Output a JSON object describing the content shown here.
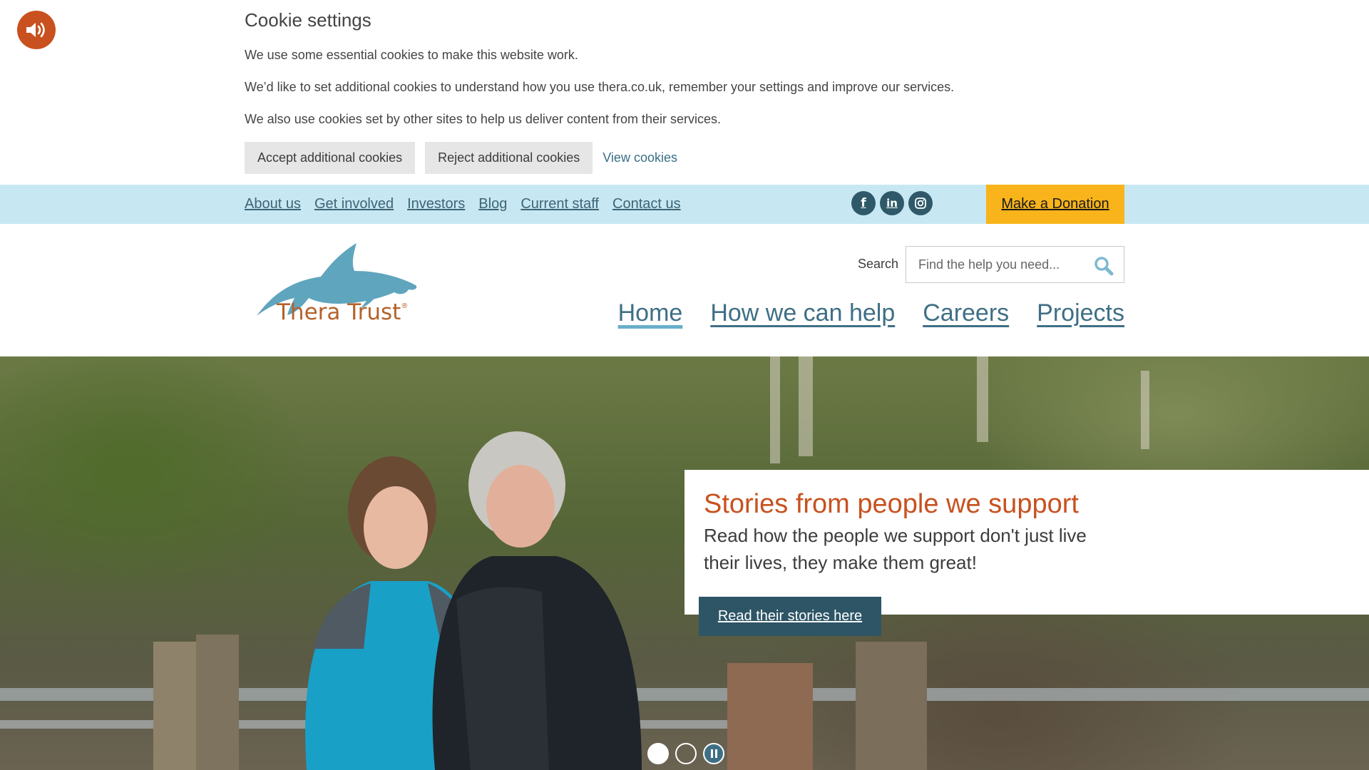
{
  "accessibility": {
    "speaker_icon": "speaker-volume-icon"
  },
  "cookie": {
    "title": "Cookie settings",
    "p1": "We use some essential cookies to make this website work.",
    "p2": "We’d like to set additional cookies to understand how you use thera.co.uk, remember your settings and improve our services.",
    "p3": "We also use cookies set by other sites to help us deliver content from their services.",
    "accept_label": "Accept additional cookies",
    "reject_label": "Reject additional cookies",
    "view_label": "View cookies"
  },
  "topbar": {
    "links": [
      "About us",
      "Get involved",
      "Investors",
      "Blog",
      "Current staff",
      "Contact us"
    ],
    "social": [
      "facebook-icon",
      "linkedin-icon",
      "instagram-icon"
    ],
    "donate_label": "Make a Donation"
  },
  "header": {
    "logo_text": "Thera Trust",
    "logo_mark": "®",
    "search_label": "Search",
    "search_placeholder": "Find the help you need..."
  },
  "mainnav": {
    "items": [
      "Home",
      "How we can help",
      "Careers",
      "Projects"
    ],
    "active": "Home"
  },
  "hero": {
    "title": "Stories from people we support",
    "text": "Read how the people we support don't just live their lives, they make them great!",
    "button_label": "Read their stories here",
    "slides": 2,
    "current_slide": 1
  },
  "colors": {
    "accent_orange": "#c8511f",
    "topbar_bg": "#c7e8f3",
    "donate_bg": "#f8b41a",
    "nav_link": "#3e6f85",
    "button_dark": "#2d5566"
  }
}
